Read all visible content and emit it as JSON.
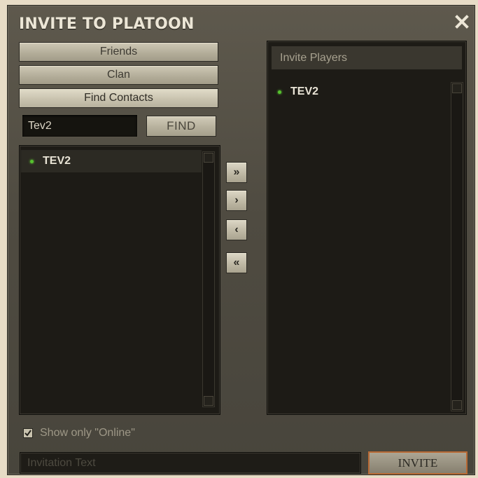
{
  "window": {
    "title": "INVITE TO PLATOON",
    "close_icon": "close-icon"
  },
  "tabs": [
    {
      "label": "Friends"
    },
    {
      "label": "Clan"
    },
    {
      "label": "Find Contacts"
    }
  ],
  "search": {
    "value": "Tev2",
    "button_label": "FIND"
  },
  "search_results": [
    {
      "name": "TEV2",
      "status": "online"
    }
  ],
  "transfer_buttons": {
    "add_all": "»",
    "add": "›",
    "remove": "‹",
    "remove_all": "«"
  },
  "invite_list": {
    "header": "Invite Players",
    "players": [
      {
        "name": "TEV2",
        "status": "online"
      }
    ]
  },
  "filter": {
    "label": "Show only \"Online\"",
    "checked": true
  },
  "invitation": {
    "placeholder": "Invitation Text",
    "button_label": "INVITE"
  },
  "colors": {
    "online_dot": "#55c22e",
    "invite_button_border": "#b86a35"
  }
}
